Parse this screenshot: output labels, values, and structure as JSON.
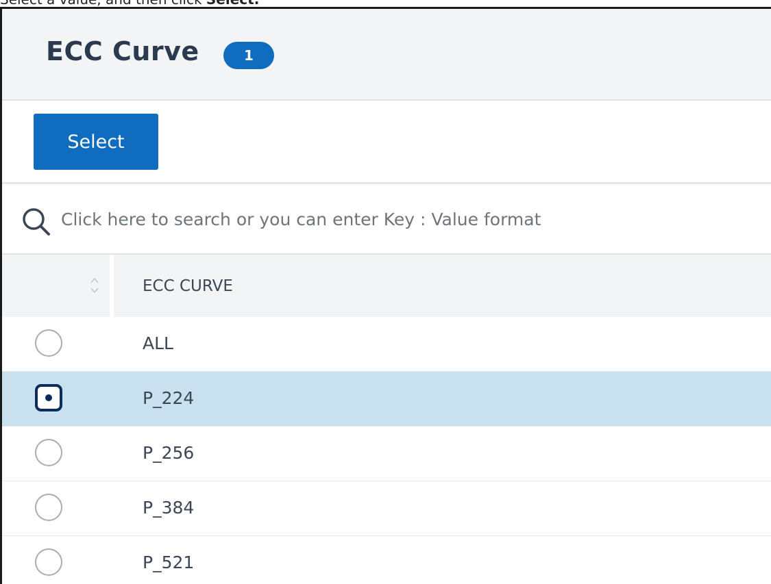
{
  "instruction": {
    "prefix": "Select a value, and then click ",
    "emphasis": "Select."
  },
  "header": {
    "title": "ECC Curve",
    "count_badge": "1"
  },
  "toolbar": {
    "select_label": "Select"
  },
  "search": {
    "icon": "search-icon",
    "placeholder": "Click here to search or you can enter Key : Value format",
    "value": ""
  },
  "table": {
    "sort_icon": "sort-icon",
    "column_header": "ECC CURVE",
    "rows": [
      {
        "label": "ALL",
        "selected": false
      },
      {
        "label": "P_224",
        "selected": true
      },
      {
        "label": "P_256",
        "selected": false
      },
      {
        "label": "P_384",
        "selected": false
      },
      {
        "label": "P_521",
        "selected": false
      }
    ]
  },
  "colors": {
    "primary_blue": "#0f6cbf",
    "selected_row": "#c9e0ef",
    "radio_checked": "#0c2d5a",
    "header_bg": "#f3f4f6",
    "title_text": "#2b3a4f"
  }
}
